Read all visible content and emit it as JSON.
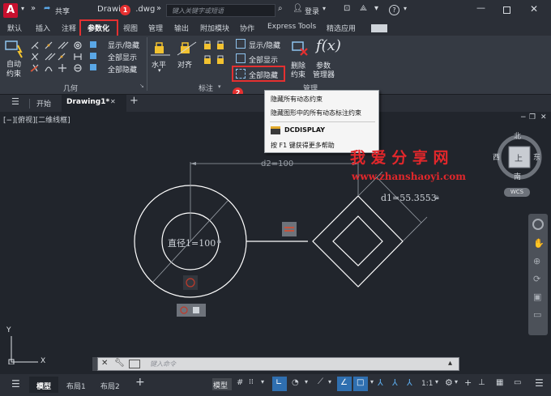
{
  "titlebar": {
    "logo": "A",
    "share": "共享",
    "filename": "Drawin",
    "filename_suffix": ".dwg",
    "search_placeholder": "键入关键字或短语",
    "login": "登录"
  },
  "ribbon_tabs": [
    "默认",
    "插入",
    "注释",
    "参数化",
    "视图",
    "管理",
    "输出",
    "附加模块",
    "协作",
    "Express Tools",
    "精选应用"
  ],
  "ribbon": {
    "auto_constrain": "自动\n约束",
    "auto_constrain_l1": "自动",
    "auto_constrain_l2": "约束",
    "show_hide": "显示/隐藏",
    "show_all": "全部显示",
    "hide_all": "全部隐藏",
    "geometry_label": "几何",
    "horizontal": "水平",
    "aligned": "对齐",
    "dim_show_hide": "显示/隐藏",
    "dim_show_all": "全部显示",
    "dim_hide_all": "全部隐藏",
    "dimension_label": "标注",
    "delete_constraint_l1": "删除",
    "delete_constraint_l2": "约束",
    "param_manager_l1": "参数",
    "param_manager_l2": "管理器",
    "manage_label": "管理",
    "fx": "f(x)"
  },
  "callouts": {
    "one": "1",
    "two": "2"
  },
  "filetabs": {
    "start": "开始",
    "drawing": "Drawing1*"
  },
  "tooltip": {
    "title": "隐藏所有动态约束",
    "desc": "隐藏图形中的所有动态标注约束",
    "command": "DCDISPLAY",
    "help": "按 F1 键获得更多帮助"
  },
  "viewport_label": "[−][俯视][二维线框]",
  "drawing": {
    "dim_top": "d2=100",
    "dim_diamond": "d1=55.3553",
    "dim_diameter": "直径1=100"
  },
  "viewcube": {
    "north": "北",
    "south": "南",
    "east": "东",
    "west": "西",
    "top": "上",
    "wcs": "WCS"
  },
  "ucs": {
    "x": "X",
    "y": "Y"
  },
  "watermark": {
    "line1": "我 爱 分 享 网",
    "line2": "www.zhanshaoyi.com"
  },
  "cmdline": {
    "placeholder": "键入命令"
  },
  "status": {
    "model_tab": "模型",
    "layout1": "布局1",
    "layout2": "布局2",
    "model_btn": "模型",
    "scale": "1:1"
  }
}
